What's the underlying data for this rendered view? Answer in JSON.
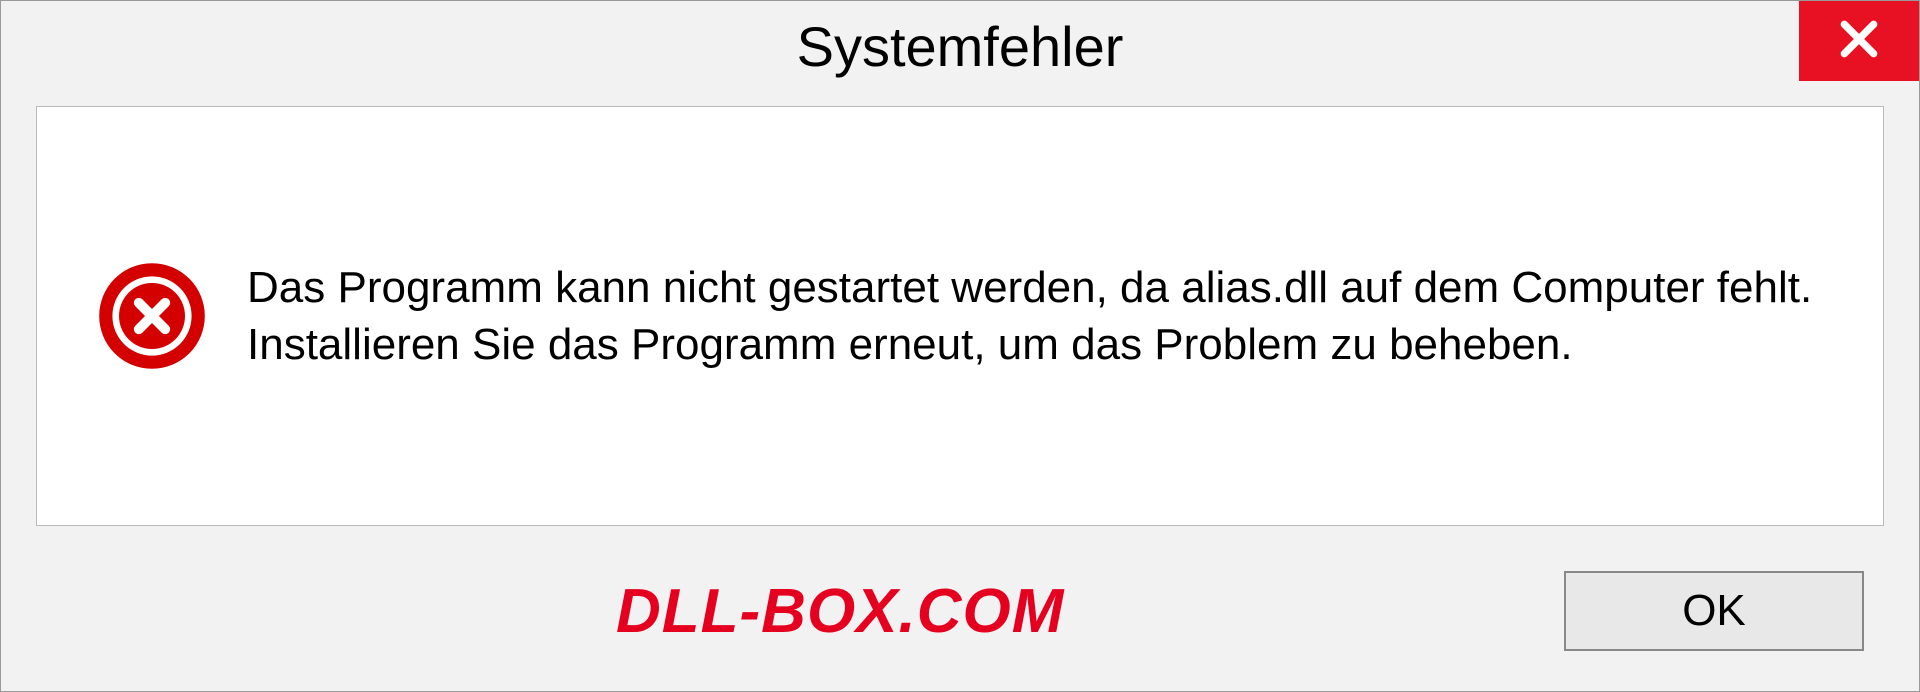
{
  "dialog": {
    "title": "Systemfehler",
    "message": "Das Programm kann nicht gestartet werden, da alias.dll auf dem Computer fehlt. Installieren Sie das Programm erneut, um das Problem zu beheben.",
    "ok_label": "OK"
  },
  "watermark": "DLL-BOX.COM",
  "colors": {
    "close_bg": "#e81123",
    "error_icon": "#d40000",
    "watermark": "#e6001f"
  }
}
